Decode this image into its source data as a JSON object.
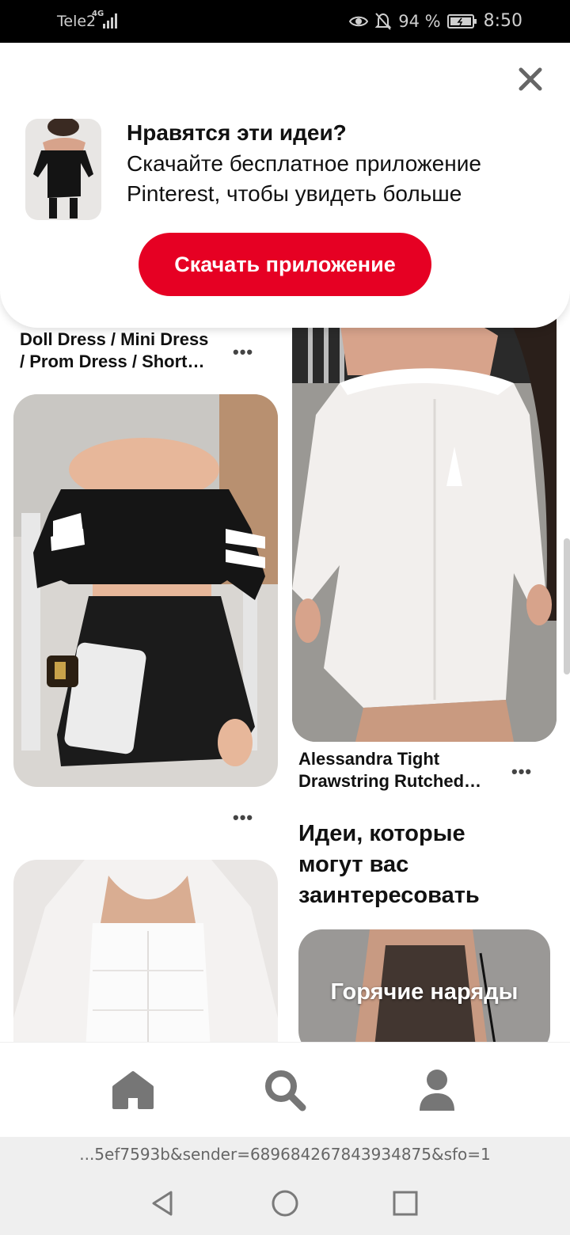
{
  "status_bar": {
    "carrier": "Tele2",
    "network": "4G",
    "battery": "94 %",
    "time": "8:50"
  },
  "popup": {
    "heading": "Нравятся эти идеи?",
    "line1": "Скачайте бесплатное приложение",
    "line2": "Pinterest, чтобы увидеть больше",
    "button_label": "Скачать приложение"
  },
  "feed": {
    "pin1_title_line1": "Doll Dress / Mini Dress",
    "pin1_title_line2": "/ Prom Dress / Short…",
    "pin3_title_line1": "Alessandra Tight",
    "pin3_title_line2": "Drawstring Rutched…",
    "more_glyph": "•••"
  },
  "ideas": {
    "title_line1": "Идеи, которые",
    "title_line2": "могут вас",
    "title_line3": "заинтересовать",
    "card_label": "Горячие наряды"
  },
  "url_bar": {
    "text": "...5ef7593b&sender=689684267843934875&sfo=1"
  },
  "icons": [
    "eye-icon",
    "bell-off-icon",
    "battery-icon",
    "close-icon",
    "home-icon",
    "search-icon",
    "profile-icon",
    "back-icon",
    "home-circle-icon",
    "recents-icon"
  ]
}
